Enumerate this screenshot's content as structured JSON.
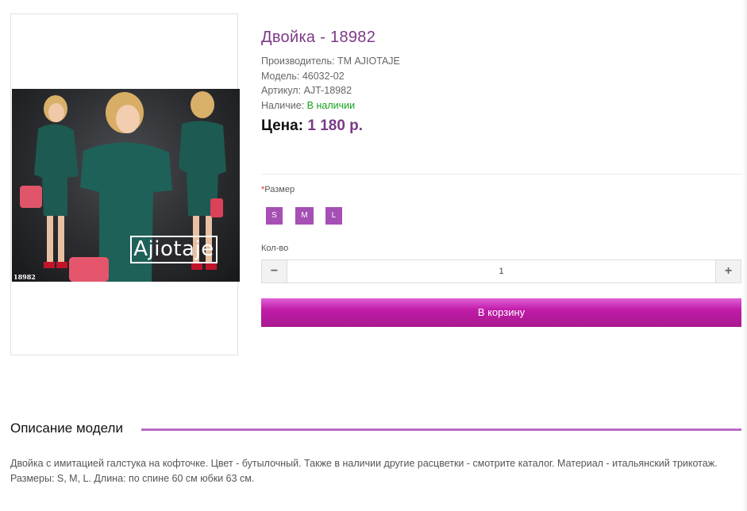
{
  "product": {
    "title": "Двойка - 18982",
    "image_brand_text": "Ajiotaje",
    "image_code": "18982",
    "manufacturer_label": "Производитель:",
    "manufacturer_value": "ТМ AJIOTAJE",
    "model_label": "Модель:",
    "model_value": "46032-02",
    "sku_label": "Артикул:",
    "sku_value": "AJT-18982",
    "availability_label": "Наличие:",
    "availability_value": "В наличии",
    "price_label": "Цена:",
    "price_value": "1 180 р."
  },
  "options": {
    "size_required_mark": "*",
    "size_label": "Размер",
    "sizes": [
      "S",
      "M",
      "L"
    ],
    "quantity_label": "Кол-во",
    "quantity_value": "1",
    "minus_symbol": "−",
    "plus_symbol": "+"
  },
  "cart": {
    "button_label": "В корзину"
  },
  "description": {
    "heading": "Описание модели",
    "text": "Двойка с имитацией галстука на кофточке. Цвет - бутылочный. Также в наличии другие расцветки - смотрите каталог. Материал - итальянский трикотаж. Размеры: S, M, L. Длина: по спине 60 см юбки 63 см."
  },
  "colors": {
    "accent": "#7b3a86",
    "size_button": "#a64fb4",
    "cart_button": "#c01ca8",
    "in_stock": "#18a01c"
  },
  "icons": {
    "minus": "minus-icon",
    "plus": "plus-icon"
  }
}
